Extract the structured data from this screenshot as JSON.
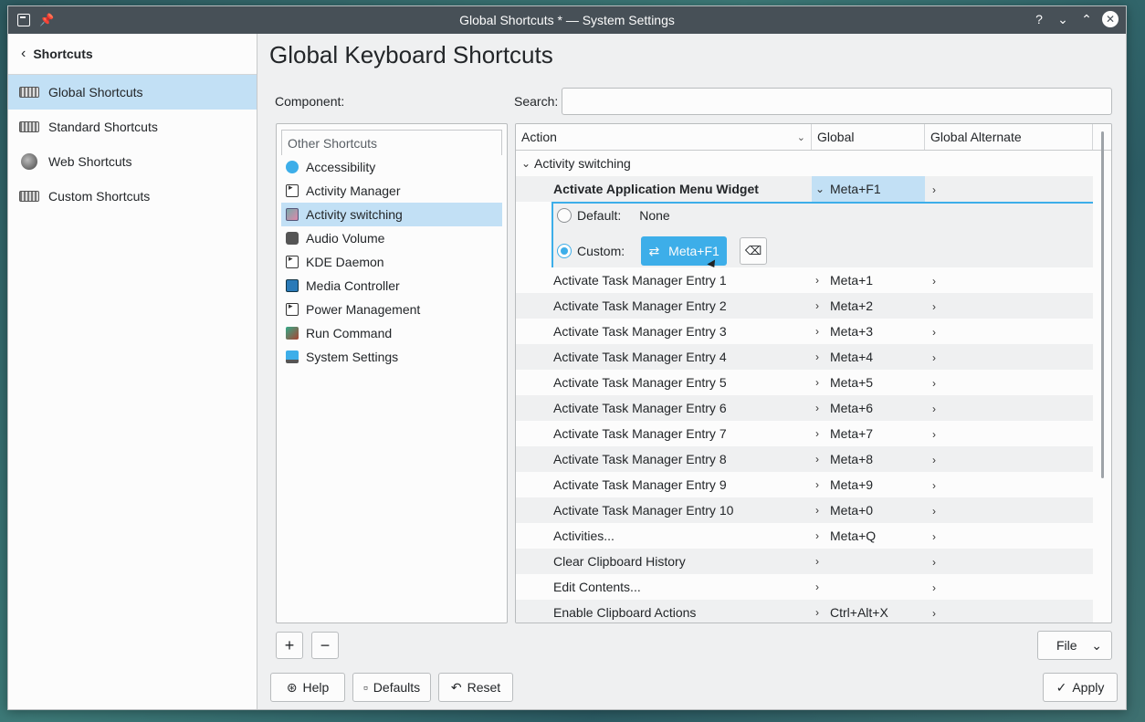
{
  "window": {
    "title": "Global Shortcuts * — System Settings"
  },
  "titlebar": {
    "help": "?",
    "minimize": "⌄",
    "maximize": "⌃",
    "close": "✕"
  },
  "sidebar": {
    "header": "Shortcuts",
    "items": [
      {
        "label": "Global Shortcuts",
        "icon": "keyboard-icon"
      },
      {
        "label": "Standard Shortcuts",
        "icon": "keyboard-icon"
      },
      {
        "label": "Web Shortcuts",
        "icon": "globe-icon"
      },
      {
        "label": "Custom Shortcuts",
        "icon": "keyboard-icon"
      }
    ]
  },
  "main": {
    "title": "Global Keyboard Shortcuts",
    "component_label": "Component:",
    "search_label": "Search:",
    "search_value": ""
  },
  "components": {
    "header": "Other Shortcuts",
    "items": [
      "Accessibility",
      "Activity Manager",
      "Activity switching",
      "Audio Volume",
      "KDE Daemon",
      "Media Controller",
      "Power Management",
      "Run Command",
      "System Settings"
    ]
  },
  "table": {
    "columns": [
      "Action",
      "Global",
      "Global Alternate"
    ],
    "group": "Activity switching",
    "selected": {
      "action": "Activate Application Menu Widget",
      "global": "Meta+F1"
    },
    "editor": {
      "default_label": "Default:",
      "default_value": "None",
      "custom_label": "Custom:",
      "custom_value": "Meta+F1"
    },
    "rows": [
      {
        "action": "Activate Task Manager Entry 1",
        "global": "Meta+1"
      },
      {
        "action": "Activate Task Manager Entry 2",
        "global": "Meta+2"
      },
      {
        "action": "Activate Task Manager Entry 3",
        "global": "Meta+3"
      },
      {
        "action": "Activate Task Manager Entry 4",
        "global": "Meta+4"
      },
      {
        "action": "Activate Task Manager Entry 5",
        "global": "Meta+5"
      },
      {
        "action": "Activate Task Manager Entry 6",
        "global": "Meta+6"
      },
      {
        "action": "Activate Task Manager Entry 7",
        "global": "Meta+7"
      },
      {
        "action": "Activate Task Manager Entry 8",
        "global": "Meta+8"
      },
      {
        "action": "Activate Task Manager Entry 9",
        "global": "Meta+9"
      },
      {
        "action": "Activate Task Manager Entry 10",
        "global": "Meta+0"
      },
      {
        "action": "Activities...",
        "global": "Meta+Q"
      },
      {
        "action": "Clear Clipboard History",
        "global": ""
      },
      {
        "action": "Edit Contents...",
        "global": ""
      },
      {
        "action": "Enable Clipboard Actions",
        "global": "Ctrl+Alt+X"
      }
    ]
  },
  "buttons": {
    "add": "+",
    "remove": "−",
    "file": "File",
    "help": "Help",
    "defaults": "Defaults",
    "reset": "Reset",
    "apply": "Apply"
  },
  "colors": {
    "accent": "#3daee9",
    "selection": "#c2e0f5",
    "titlebar": "#475057"
  }
}
